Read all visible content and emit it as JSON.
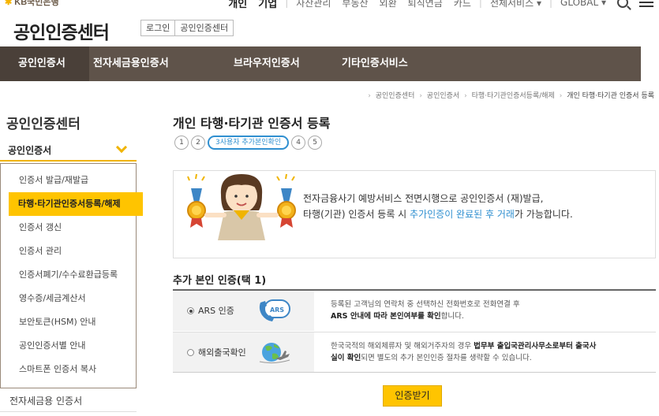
{
  "header": {
    "logo_text": "KB국민은행",
    "topnav": [
      "개인",
      "기업",
      "자산관리",
      "부동산",
      "외환",
      "퇴직연금",
      "카드",
      "전체서비스 ▾",
      "GLOBAL ▾"
    ],
    "site_title": "공인인증센터",
    "login_link": "로그인",
    "center_link": "공인인증센터"
  },
  "gnb": [
    "공인인증서",
    "전자세금용인증서",
    "브라우저인증서",
    "기타인증서비스"
  ],
  "breadcrumb": [
    "공인인증센터",
    "공인인증서",
    "타행·타기관인증서등록/해제",
    "개인 타행·타기관 인증서 등록"
  ],
  "sidebar": {
    "title": "공인인증센터",
    "section": "공인인증서",
    "items": [
      "인증서 발급/재발급",
      "타행·타기관인증서등록/해제",
      "인증서 갱신",
      "인증서 관리",
      "인증서폐기/수수료환급등록",
      "영수증/세금계산서",
      "보안토큰(HSM) 안내",
      "공인인증서별 안내",
      "스마트폰 인증서 복사"
    ],
    "active_index": 1,
    "footer_item": "전자세금용 인증서"
  },
  "main": {
    "title": "개인 타행·타기관 인증서 등록",
    "steps": [
      "1",
      "2",
      "3사용자 추가본인확인",
      "4",
      "5"
    ],
    "active_step": 2,
    "notice": {
      "line1": "전자금융사기 예방서비스 전면시행으로 공인인증서 (재)발급,",
      "line2_pre": "타행(기관) 인증서 등록 시 ",
      "line2_hl": "추가인증이 완료된 후 거래",
      "line2_post": "가 가능합니다."
    },
    "section_title": "추가 본인 인증(택 1)",
    "options": [
      {
        "label": "ARS 인증",
        "icon_text": "ARS",
        "selected": true,
        "desc1_pre": "등록된 고객님의 연락처 중 선택하신 전화번호로 전화연결 후",
        "desc2_bold": "ARS 안내에 따라 본인여부를 확인",
        "desc2_post": "합니다."
      },
      {
        "label": "해외출국확인",
        "selected": false,
        "desc1_pre": "한국국적의 해외체류자 및 해외거주자의 경우 ",
        "desc1_bold": "법무부 출입국관리사무소로부터 출국사",
        "desc2_bold": "실이 확인",
        "desc2_post": "되면 별도의 추가 본인인증 절차를 생략할 수 있습니다."
      }
    ],
    "submit_label": "인증받기"
  },
  "colors": {
    "gnb_bg": "#5f534a",
    "accent_yellow": "#ffc400",
    "link_blue": "#2f8fd0"
  }
}
